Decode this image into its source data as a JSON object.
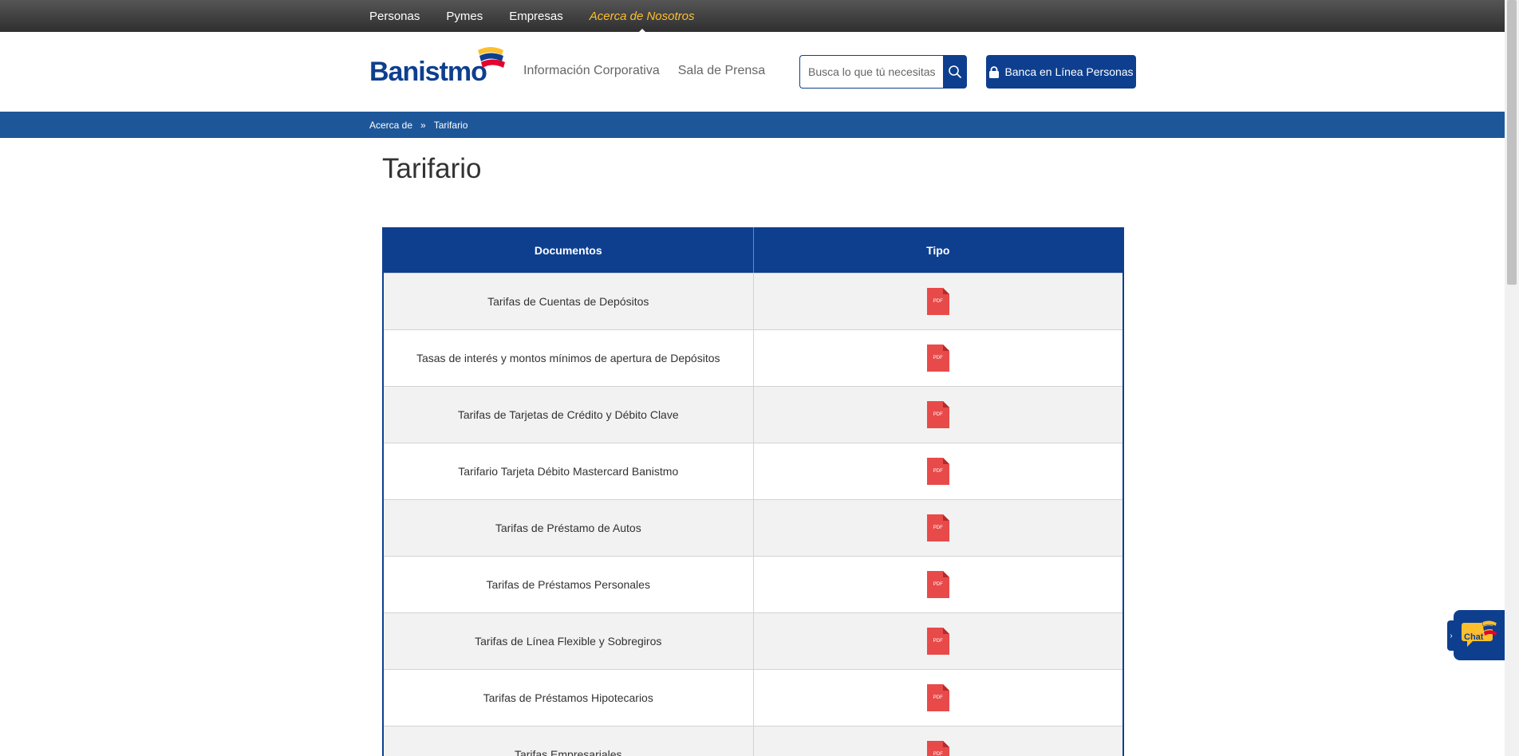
{
  "topnav": {
    "items": [
      "Personas",
      "Pymes",
      "Empresas"
    ],
    "active": "Acerca de Nosotros"
  },
  "header": {
    "logo_text": "Banistmo",
    "nav": [
      "Información Corporativa",
      "Sala de Prensa"
    ],
    "search_placeholder": "Busca lo que tú necesitas",
    "online_banking": "Banca en Línea Personas"
  },
  "breadcrumb": {
    "items": [
      "Acerca de",
      "»",
      "Tarifario"
    ]
  },
  "page": {
    "title": "Tarifario"
  },
  "table": {
    "headers": [
      "Documentos",
      "Tipo"
    ],
    "pdf_label": "PDF",
    "rows": [
      "Tarifas de Cuentas de Depósitos",
      "Tasas de interés y montos mínimos de apertura de Depósitos",
      "Tarifas de Tarjetas de Crédito y Débito Clave",
      "Tarifario Tarjeta Débito Mastercard Banistmo",
      "Tarifas de Préstamo de Autos",
      "Tarifas de Préstamos Personales",
      "Tarifas de Línea Flexible y Sobregiros",
      "Tarifas de Préstamos Hipotecarios",
      "Tarifas Empresariales"
    ]
  },
  "chat": {
    "label": "Chat",
    "tab_glyph": "›"
  },
  "colors": {
    "brand_blue": "#0e3f8f",
    "breadcrumb_blue": "#1e5799",
    "accent_yellow": "#fdbf2d",
    "pdf_red": "#e84a4a"
  }
}
